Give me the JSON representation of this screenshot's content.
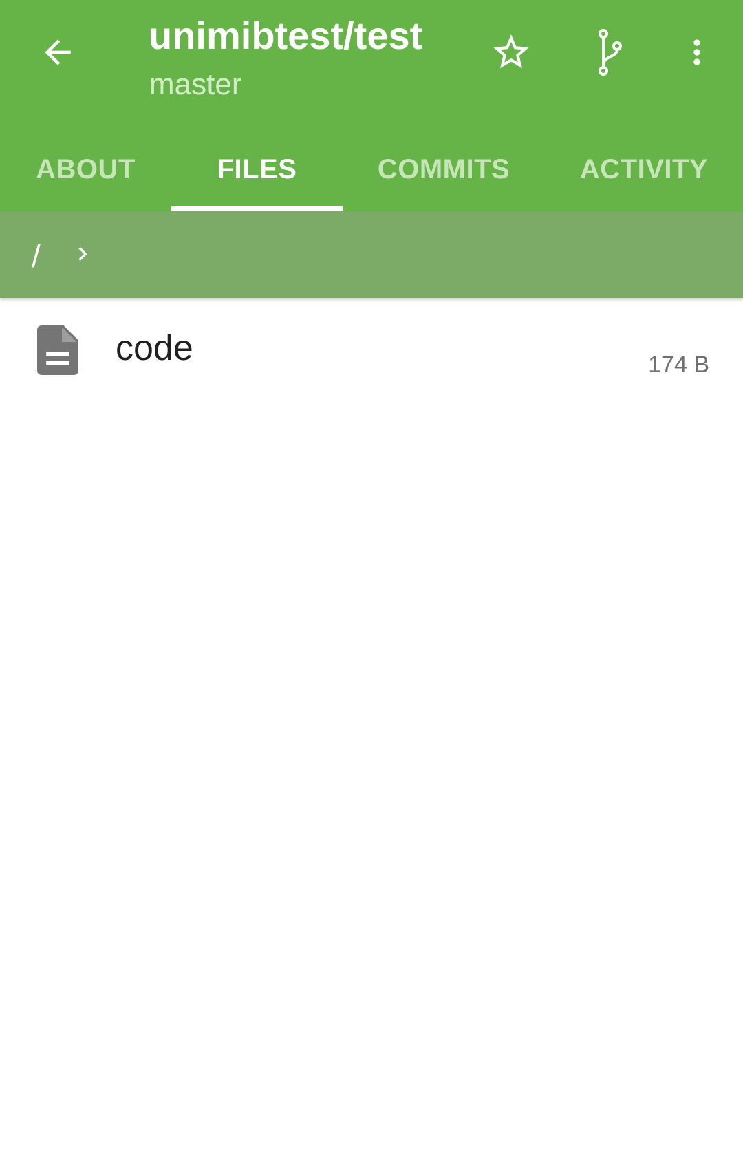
{
  "header": {
    "title": "unimibtest/test",
    "subtitle": "master",
    "icons": {
      "back": "arrow-back-icon",
      "star": "star-outline-icon",
      "branch": "git-branch-icon",
      "more": "more-vertical-icon"
    }
  },
  "tabs": [
    {
      "label": "ABOUT",
      "active": false
    },
    {
      "label": "FILES",
      "active": true
    },
    {
      "label": "COMMITS",
      "active": false
    },
    {
      "label": "ACTIVITY",
      "active": false
    }
  ],
  "breadcrumb": {
    "root": "/",
    "separator_icon": "chevron-right-icon"
  },
  "files": [
    {
      "name": "code",
      "size": "174 B",
      "icon": "file-document-icon"
    }
  ],
  "colors": {
    "appbar": "#66b447",
    "breadcrumb_bar": "#7caa67",
    "tab_inactive": "#c6e6b8",
    "tab_active": "#ffffff"
  }
}
